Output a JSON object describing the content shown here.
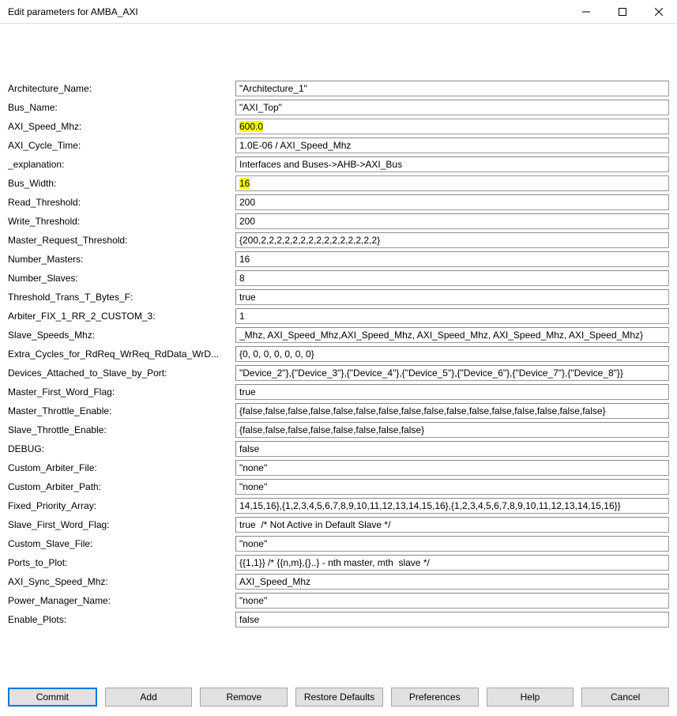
{
  "window": {
    "title": "Edit parameters for AMBA_AXI"
  },
  "params": [
    {
      "label": "Architecture_Name:",
      "value": "\"Architecture_1\"",
      "highlight": false
    },
    {
      "label": "Bus_Name:",
      "value": "\"AXI_Top\"",
      "highlight": false
    },
    {
      "label": "AXI_Speed_Mhz:",
      "value": "600.0",
      "highlight": true
    },
    {
      "label": "AXI_Cycle_Time:",
      "value": "1.0E-06 / AXI_Speed_Mhz",
      "highlight": false
    },
    {
      "label": "_explanation:",
      "value": "Interfaces and Buses->AHB->AXI_Bus",
      "highlight": false
    },
    {
      "label": "Bus_Width:",
      "value": "16",
      "highlight": true
    },
    {
      "label": "Read_Threshold:",
      "value": "200",
      "highlight": false
    },
    {
      "label": "Write_Threshold:",
      "value": "200",
      "highlight": false
    },
    {
      "label": "Master_Request_Threshold:",
      "value": "{200,2,2,2,2,2,2,2,2,2,2,2,2,2,2,2}",
      "highlight": false
    },
    {
      "label": "Number_Masters:",
      "value": "16",
      "highlight": false
    },
    {
      "label": "Number_Slaves:",
      "value": "8",
      "highlight": false
    },
    {
      "label": "Threshold_Trans_T_Bytes_F:",
      "value": "true",
      "highlight": false
    },
    {
      "label": "Arbiter_FIX_1_RR_2_CUSTOM_3:",
      "value": "1",
      "highlight": false
    },
    {
      "label": "Slave_Speeds_Mhz:",
      "value": "_Mhz, AXI_Speed_Mhz,AXI_Speed_Mhz, AXI_Speed_Mhz, AXI_Speed_Mhz, AXI_Speed_Mhz}",
      "highlight": false
    },
    {
      "label": "Extra_Cycles_for_RdReq_WrReq_RdData_WrD...",
      "value": "{0, 0, 0, 0, 0, 0, 0}",
      "highlight": false
    },
    {
      "label": "Devices_Attached_to_Slave_by_Port:",
      "value": "\"Device_2\"},{\"Device_3\"},{\"Device_4\"},{\"Device_5\"},{\"Device_6\"},{\"Device_7\"},{\"Device_8\"}}",
      "highlight": false
    },
    {
      "label": "Master_First_Word_Flag:",
      "value": "true",
      "highlight": false
    },
    {
      "label": "Master_Throttle_Enable:",
      "value": "{false,false,false,false,false,false,false,false,false,false,false,false,false,false,false,false}",
      "highlight": false
    },
    {
      "label": "Slave_Throttle_Enable:",
      "value": "{false,false,false,false,false,false,false,false}",
      "highlight": false
    },
    {
      "label": "DEBUG:",
      "value": "false",
      "highlight": false
    },
    {
      "label": "Custom_Arbiter_File:",
      "value": "\"none\"",
      "highlight": false
    },
    {
      "label": "Custom_Arbiter_Path:",
      "value": "\"none\"",
      "highlight": false
    },
    {
      "label": "Fixed_Priority_Array:",
      "value": "14,15,16},{1,2,3,4,5,6,7,8,9,10,11,12,13,14,15,16},{1,2,3,4,5,6,7,8,9,10,11,12,13,14,15,16}}",
      "highlight": false
    },
    {
      "label": "Slave_First_Word_Flag:",
      "value": "true  /* Not Active in Default Slave */",
      "highlight": false
    },
    {
      "label": "Custom_Slave_File:",
      "value": "\"none\"",
      "highlight": false
    },
    {
      "label": "Ports_to_Plot:",
      "value": "{{1,1}} /* {{n,m},{}..} - nth master, mth  slave */",
      "highlight": false
    },
    {
      "label": "AXI_Sync_Speed_Mhz:",
      "value": "AXI_Speed_Mhz",
      "highlight": false
    },
    {
      "label": "Power_Manager_Name:",
      "value": "\"none\"",
      "highlight": false
    },
    {
      "label": "Enable_Plots:",
      "value": "false",
      "highlight": false
    }
  ],
  "buttons": {
    "commit": "Commit",
    "add": "Add",
    "remove": "Remove",
    "restore": "Restore Defaults",
    "preferences": "Preferences",
    "help": "Help",
    "cancel": "Cancel"
  }
}
